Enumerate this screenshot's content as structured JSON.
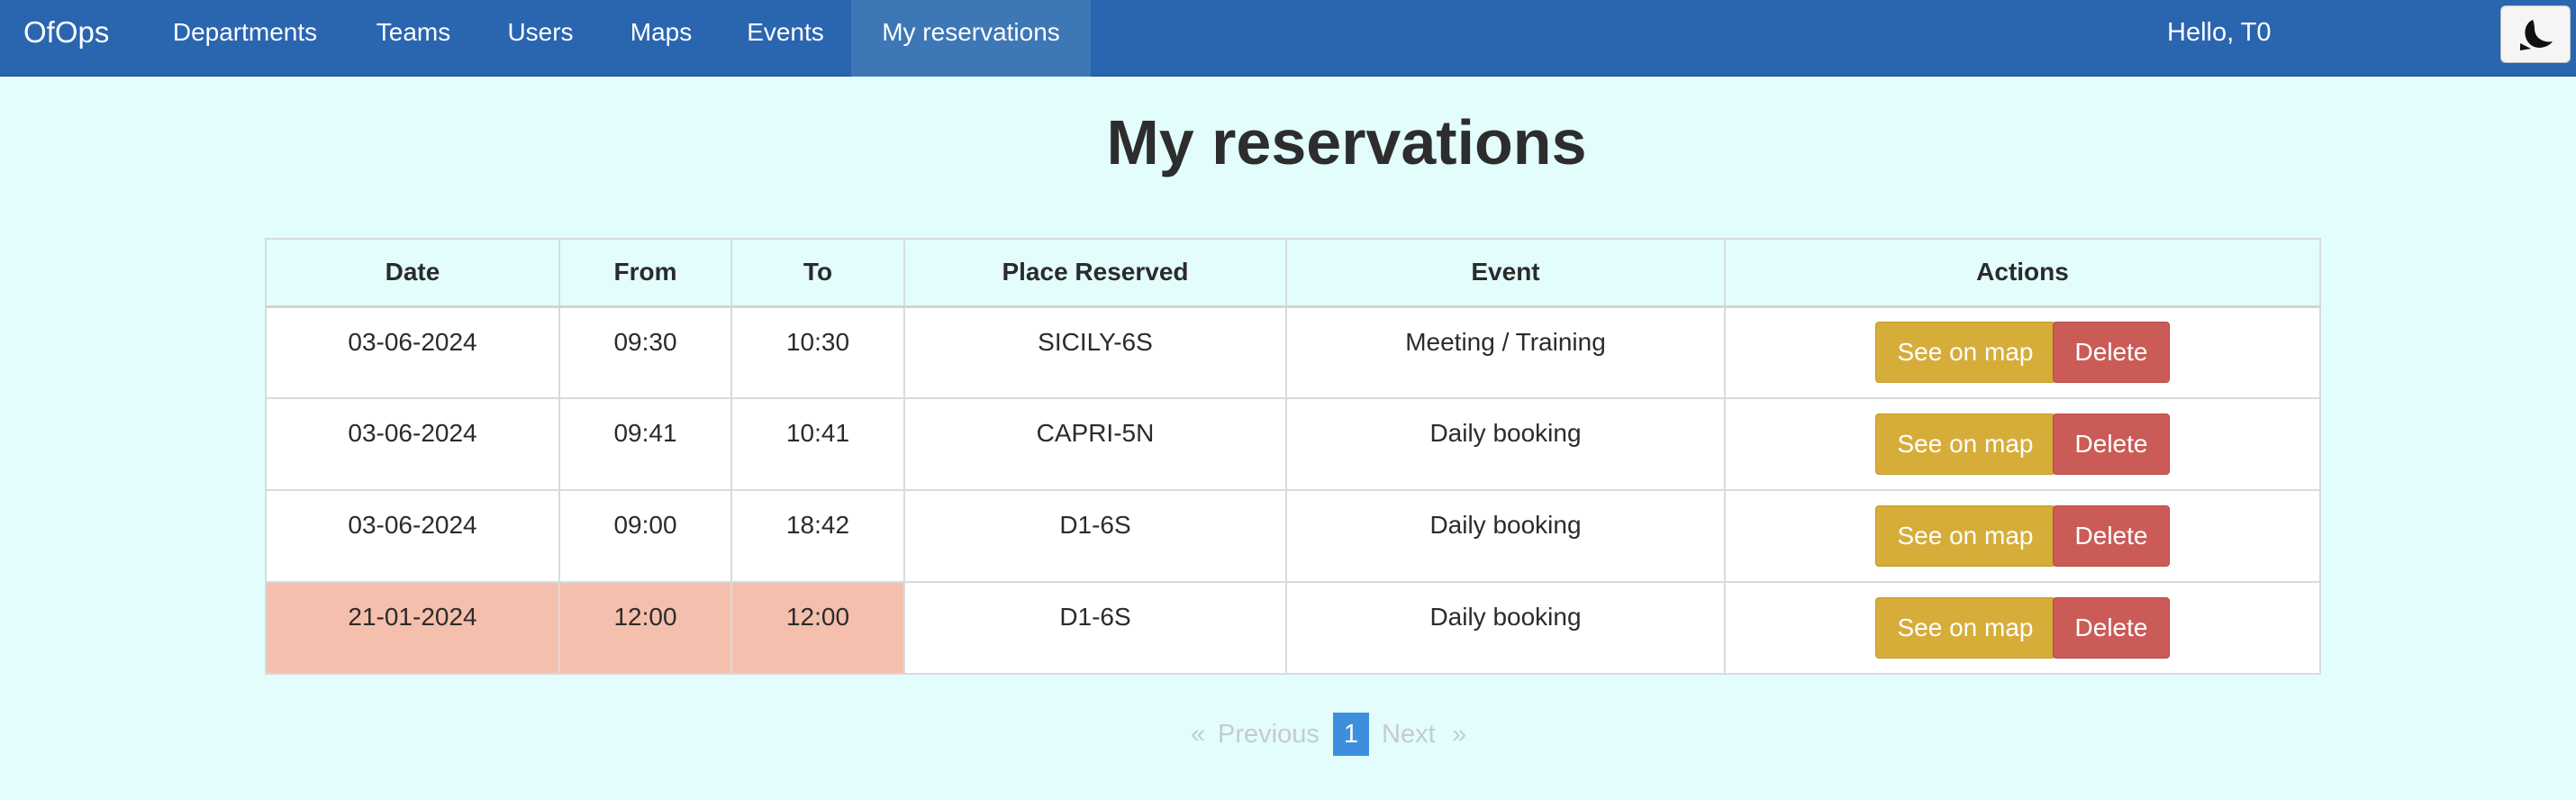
{
  "nav": {
    "brand": "OfOps",
    "items": [
      "Departments",
      "Teams",
      "Users",
      "Maps",
      "Events",
      "My reservations"
    ],
    "active": "My reservations",
    "greeting": "Hello, T0",
    "theme_icon": "moon-icon"
  },
  "page": {
    "title": "My reservations"
  },
  "table": {
    "headers": [
      "Date",
      "From",
      "To",
      "Place Reserved",
      "Event",
      "Actions"
    ],
    "rows": [
      {
        "date": "03-06-2024",
        "from": "09:30",
        "to": "10:30",
        "place": "SICILY-6S",
        "event": "Meeting / Training",
        "past": false
      },
      {
        "date": "03-06-2024",
        "from": "09:41",
        "to": "10:41",
        "place": "CAPRI-5N",
        "event": "Daily booking",
        "past": false
      },
      {
        "date": "03-06-2024",
        "from": "09:00",
        "to": "18:42",
        "place": "D1-6S",
        "event": "Daily booking",
        "past": false
      },
      {
        "date": "21-01-2024",
        "from": "12:00",
        "to": "12:00",
        "place": "D1-6S",
        "event": "Daily booking",
        "past": true
      }
    ],
    "see_on_map_label": "See on map",
    "delete_label": "Delete"
  },
  "pagination": {
    "prev_arrow": "«",
    "previous": "Previous",
    "current": "1",
    "next": "Next",
    "next_arrow": "»"
  },
  "colors": {
    "navbar": "#2a65b0",
    "background": "#e3fdfd",
    "past_row": "#f5bfad",
    "see_on_map": "#d6ad39",
    "delete": "#cb5b56",
    "page_active": "#3d8fde"
  }
}
